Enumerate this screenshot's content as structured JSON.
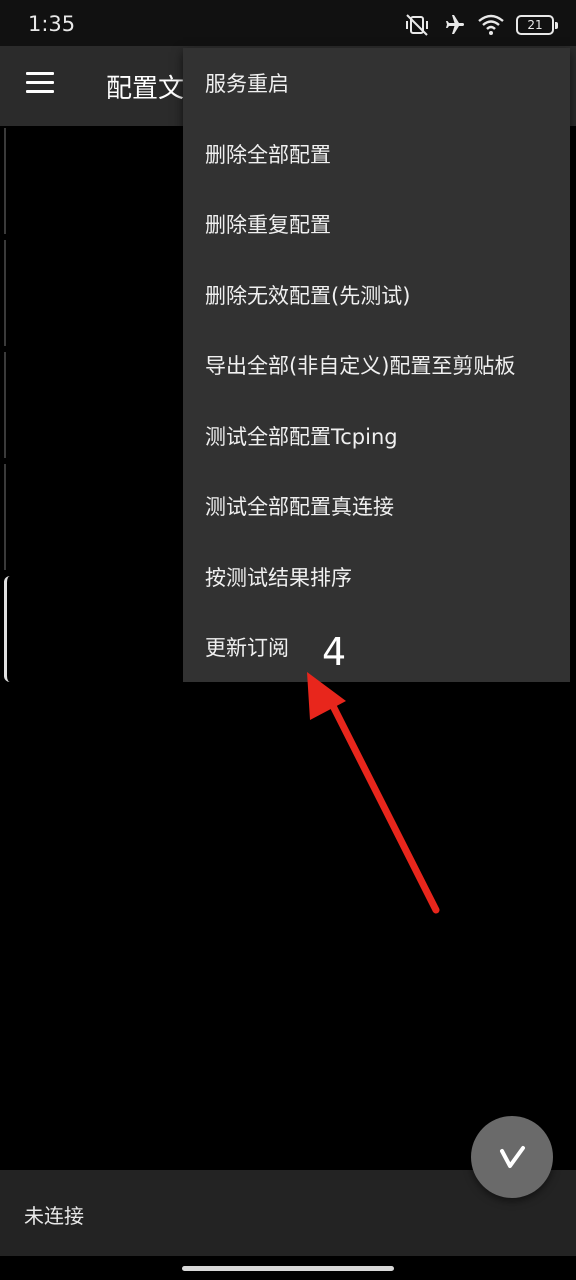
{
  "status_bar": {
    "time": "1:35",
    "battery_level": "21",
    "icons": [
      "mute-vibrate-icon",
      "airplane-icon",
      "wifi-icon",
      "battery-icon"
    ]
  },
  "app_bar": {
    "title": "配置文件",
    "menu_icon": "hamburger-menu-icon"
  },
  "overflow_menu": {
    "items": [
      {
        "label": "服务重启"
      },
      {
        "label": "删除全部配置"
      },
      {
        "label": "删除重复配置"
      },
      {
        "label": "删除无效配置(先测试)"
      },
      {
        "label": "导出全部(非自定义)配置至剪贴板"
      },
      {
        "label": "测试全部配置Tcping"
      },
      {
        "label": "测试全部配置真连接"
      },
      {
        "label": "按测试结果排序"
      },
      {
        "label": "更新订阅"
      }
    ]
  },
  "annotation": {
    "number": "4",
    "arrow_color": "#e8261c"
  },
  "bottom_bar": {
    "status": "未连接",
    "fab_icon": "v-logo-icon"
  },
  "colors": {
    "app_bar": "#2b2b2b",
    "menu_bg": "#323232",
    "background": "#000000",
    "fab": "#6a6a6a"
  }
}
